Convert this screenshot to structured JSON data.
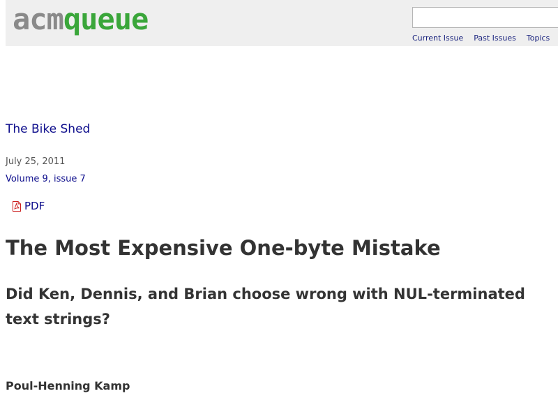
{
  "header": {
    "logo_part1": "acm",
    "logo_part2": "queue",
    "search_value": "",
    "nav": [
      "Current Issue",
      "Past Issues",
      "Topics"
    ]
  },
  "article": {
    "column": "The Bike Shed",
    "date": "July 25, 2011",
    "volume": "Volume 9, issue 7",
    "pdf_label": "PDF",
    "title": "The Most Expensive One-byte Mistake",
    "subtitle": "Did Ken, Dennis, and Brian choose wrong with NUL-terminated text strings?",
    "author": "Poul-Henning Kamp"
  },
  "colors": {
    "header_bg": "#efefef",
    "logo_gray": "#8a8a8a",
    "logo_green": "#3aa63a",
    "link_blue": "#0d0d8c",
    "heading_text": "#333333",
    "pdf_red": "#cc1f1f"
  },
  "icons": {
    "pdf": "pdf-file-icon"
  }
}
